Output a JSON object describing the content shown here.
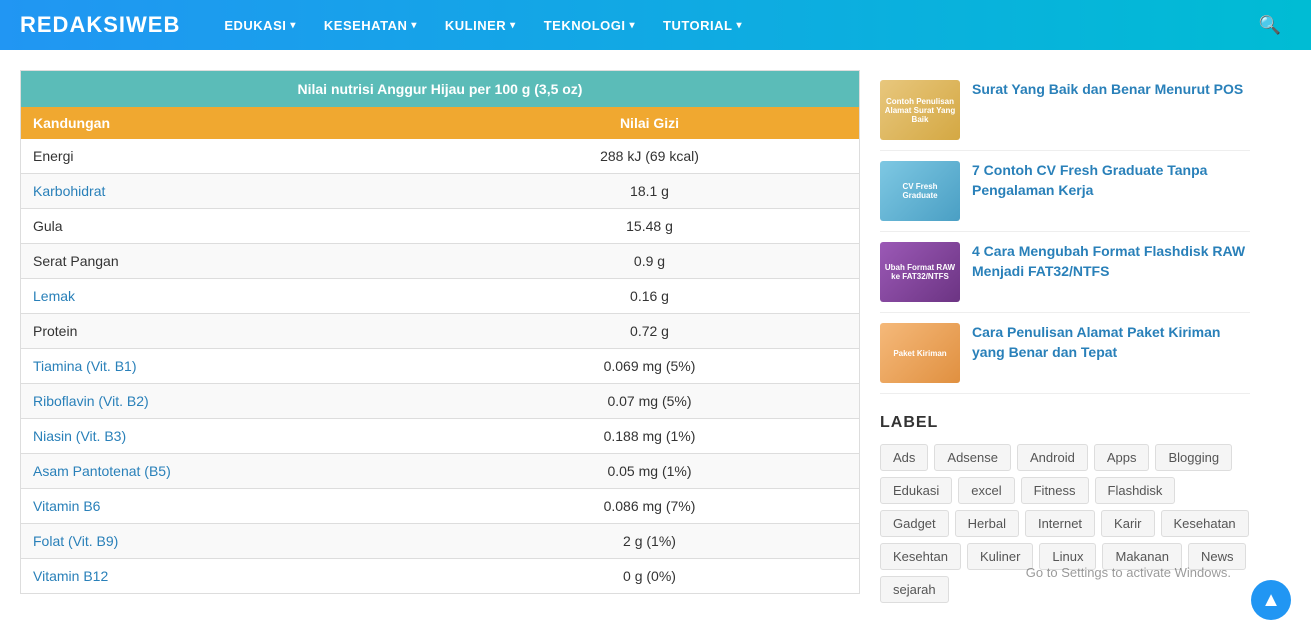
{
  "header": {
    "logo": "REDAKSIWEB",
    "nav": [
      {
        "label": "EDUKASI",
        "has_dropdown": true
      },
      {
        "label": "KESEHATAN",
        "has_dropdown": true
      },
      {
        "label": "KULINER",
        "has_dropdown": true
      },
      {
        "label": "TEKNOLOGI",
        "has_dropdown": true
      },
      {
        "label": "TUTORIAL",
        "has_dropdown": true
      }
    ]
  },
  "table": {
    "title": "Nilai nutrisi Anggur Hijau per 100 g (3,5 oz)",
    "col1": "Kandungan",
    "col2": "Nilai Gizi",
    "rows": [
      {
        "name": "Energi",
        "value": "288 kJ (69 kcal)",
        "colored": false
      },
      {
        "name": "Karbohidrat",
        "value": "18.1 g",
        "colored": true
      },
      {
        "name": "Gula",
        "value": "15.48 g",
        "colored": false
      },
      {
        "name": "Serat Pangan",
        "value": "0.9 g",
        "colored": false
      },
      {
        "name": "Lemak",
        "value": "0.16 g",
        "colored": true
      },
      {
        "name": "Protein",
        "value": "0.72 g",
        "colored": false
      },
      {
        "name": "Tiamina (Vit. B1)",
        "value": "0.069 mg (5%)",
        "colored": true
      },
      {
        "name": "Riboflavin (Vit. B2)",
        "value": "0.07 mg (5%)",
        "colored": true
      },
      {
        "name": "Niasin (Vit. B3)",
        "value": "0.188 mg (1%)",
        "colored": true
      },
      {
        "name": "Asam Pantotenat (B5)",
        "value": "0.05 mg (1%)",
        "colored": true
      },
      {
        "name": "Vitamin B6",
        "value": "0.086 mg (7%)",
        "colored": true
      },
      {
        "name": "Folat (Vit. B9)",
        "value": "2 g (1%)",
        "colored": true
      },
      {
        "name": "Vitamin B12",
        "value": "0 g (0%)",
        "colored": true
      }
    ]
  },
  "sidebar": {
    "articles": [
      {
        "title": "Surat Yang Baik dan Benar Menurut POS",
        "thumb_type": "surat",
        "thumb_text": "Contoh Penulisan Alamat Surat Yang Baik"
      },
      {
        "title": "7 Contoh CV Fresh Graduate Tanpa Pengalaman Kerja",
        "thumb_type": "cv",
        "thumb_text": "CV Fresh Graduate"
      },
      {
        "title": "4 Cara Mengubah Format Flashdisk RAW Menjadi FAT32/NTFS",
        "thumb_type": "flash",
        "thumb_text": "Ubah Format RAW ke FAT32/NTFS"
      },
      {
        "title": "Cara Penulisan Alamat Paket Kiriman yang Benar dan Tepat",
        "thumb_type": "paket",
        "thumb_text": "Paket Kiriman"
      }
    ],
    "label_heading": "LABEL",
    "tags": [
      "Ads",
      "Adsense",
      "Android",
      "Apps",
      "Blogging",
      "Edukasi",
      "excel",
      "Fitness",
      "Flashdisk",
      "Gadget",
      "Herbal",
      "Internet",
      "Karir",
      "Kesehatan",
      "Kesehtan",
      "Kuliner",
      "Linux",
      "Makanan",
      "News",
      "sejarah"
    ]
  },
  "windows_activate": "Go to Settings to activate Windows.",
  "scroll_top_icon": "▲"
}
